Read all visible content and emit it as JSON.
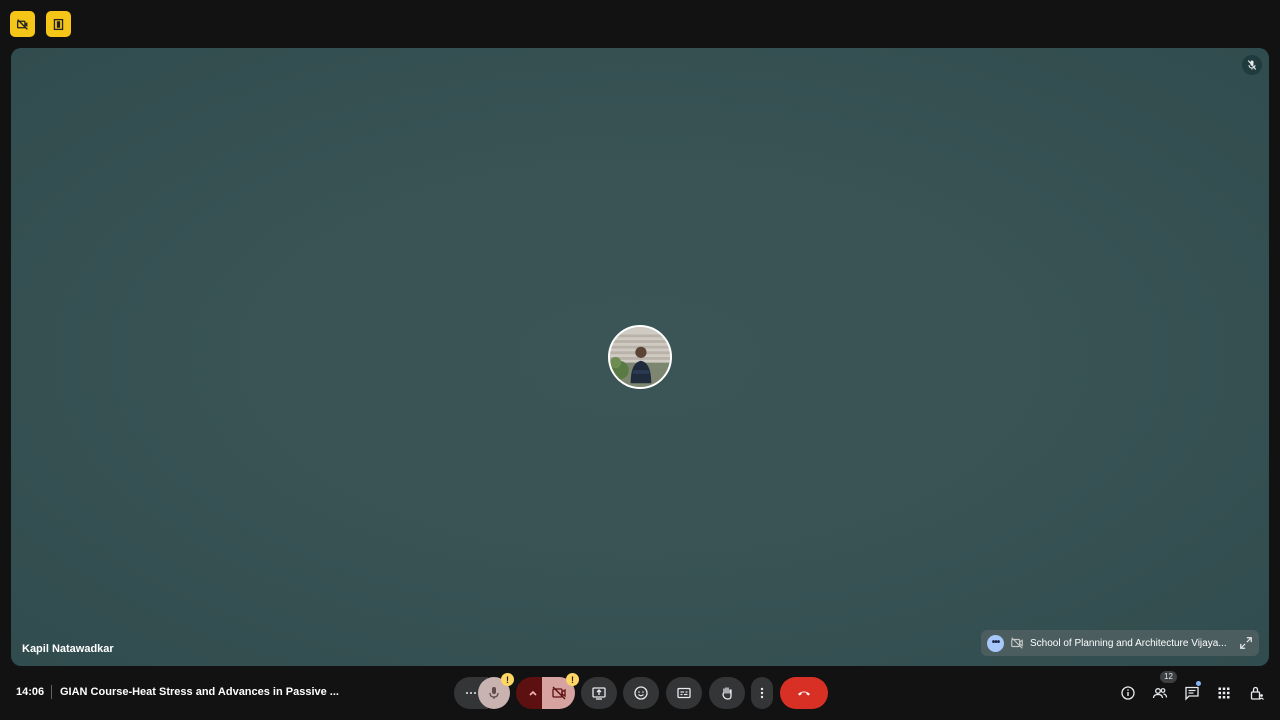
{
  "top_bar": {
    "left_buttons": [
      {
        "icon": "video-off-warning-icon"
      },
      {
        "icon": "door-exit-icon"
      }
    ]
  },
  "stage": {
    "participant_name": "Kapil Natawadkar",
    "avatar_icon": "participant-avatar-photo",
    "muted_icon": "mic-off-icon",
    "pip": {
      "title": "School of Planning and Architecture Vijaya...",
      "more_icon": "more-dots-icon",
      "camera_icon": "camera-off-icon",
      "expand_icon": "expand-icon"
    }
  },
  "bottom_bar": {
    "time": "14:06",
    "meeting_title": "GIAN Course-Heat Stress and Advances in Passive ...",
    "controls": [
      {
        "id": "more-audio",
        "icon": "ellipsis-icon"
      },
      {
        "id": "mic",
        "icon": "mic-icon",
        "alert": "!"
      },
      {
        "id": "camera-options",
        "icon": "chevron-up-icon"
      },
      {
        "id": "camera",
        "icon": "camera-off-icon",
        "alert": "!"
      },
      {
        "id": "present",
        "icon": "present-screen-icon"
      },
      {
        "id": "reactions",
        "icon": "emoji-icon"
      },
      {
        "id": "captions",
        "icon": "captions-icon"
      },
      {
        "id": "raise-hand",
        "icon": "hand-icon"
      },
      {
        "id": "more-options",
        "icon": "vertical-dots-icon"
      },
      {
        "id": "leave-call",
        "icon": "hang-up-icon"
      }
    ],
    "right_icons": [
      {
        "id": "meeting-details",
        "icon": "info-icon"
      },
      {
        "id": "people",
        "icon": "people-icon",
        "count": "12"
      },
      {
        "id": "chat",
        "icon": "chat-icon"
      },
      {
        "id": "activities",
        "icon": "apps-grid-icon"
      },
      {
        "id": "host-controls",
        "icon": "lock-person-icon"
      }
    ]
  },
  "colors": {
    "background": "#121212",
    "stage": "#3a5456",
    "warning": "#f5c518",
    "leave": "#d93025",
    "accent": "#a8c7fa"
  }
}
